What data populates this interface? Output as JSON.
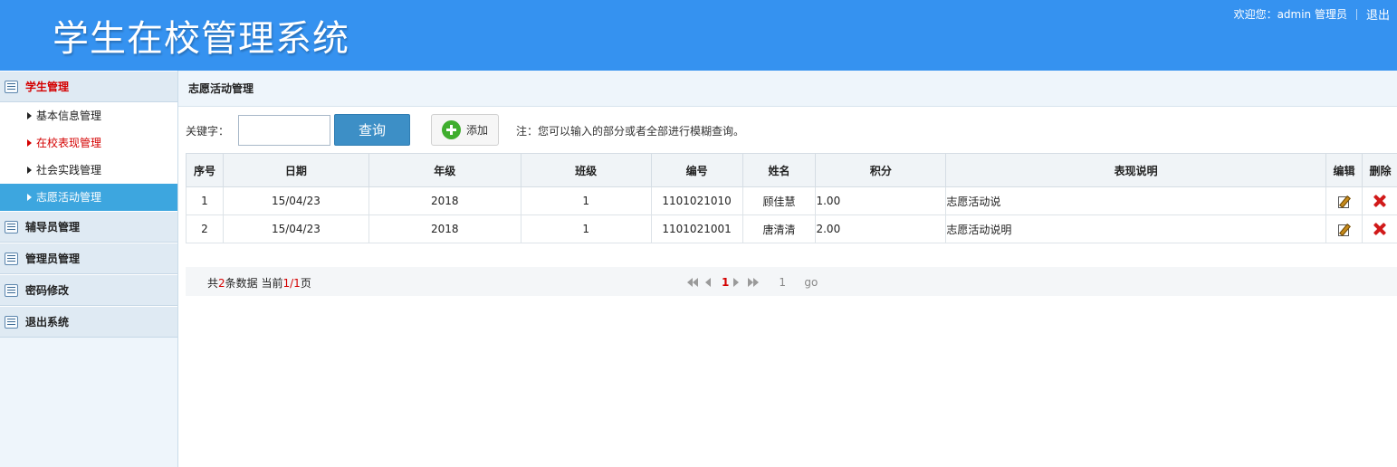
{
  "header": {
    "title": "学生在校管理系统",
    "welcome": "欢迎您：admin 管理员",
    "logout": "退出"
  },
  "sidebar": {
    "groups": [
      {
        "label": "学生管理",
        "active": true,
        "items": [
          {
            "label": "基本信息管理"
          },
          {
            "label": "在校表现管理"
          },
          {
            "label": "社会实践管理"
          },
          {
            "label": "志愿活动管理"
          }
        ]
      },
      {
        "label": "辅导员管理"
      },
      {
        "label": "管理员管理"
      },
      {
        "label": "密码修改"
      },
      {
        "label": "退出系统"
      }
    ]
  },
  "main": {
    "panel_title": "志愿活动管理",
    "search": {
      "label": "关键字：",
      "value": "",
      "button": "查询"
    },
    "add_button": "添加",
    "hint": "注：您可以输入的部分或者全部进行模糊查询。",
    "table": {
      "headers": [
        "序号",
        "日期",
        "年级",
        "班级",
        "编号",
        "姓名",
        "积分",
        "表现说明",
        "编辑",
        "删除"
      ],
      "rows": [
        [
          "1",
          "15/04/23",
          "2018",
          "1",
          "1101021010",
          "顾佳慧",
          "1.00",
          "志愿活动说"
        ],
        [
          "2",
          "15/04/23",
          "2018",
          "1",
          "1101021001",
          "唐清清",
          "2.00",
          "志愿活动说明"
        ]
      ]
    },
    "pagination": {
      "total_prefix": "共",
      "total": "2",
      "total_middle": "条数据 当前",
      "current": "1",
      "slash": "/",
      "pages": "1",
      "suffix": "页",
      "current_page_link": "1",
      "jump_value": "1",
      "go": "go"
    }
  },
  "colors": {
    "header_bg": "#3592f0",
    "sidebar_selected": "#3da6df",
    "accent_red": "#d40000",
    "query_button": "#3d8fc6"
  }
}
